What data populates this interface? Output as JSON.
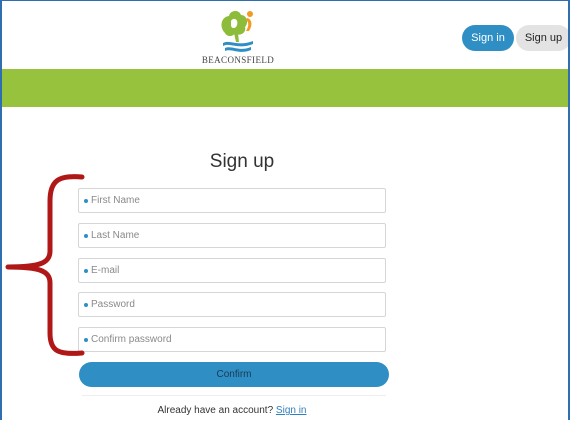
{
  "header": {
    "logo_text": "BEACONSFIELD",
    "signin_label": "Sign in",
    "signup_label": "Sign up"
  },
  "form": {
    "title": "Sign up",
    "fields": [
      {
        "placeholder": "First Name"
      },
      {
        "placeholder": "Last Name"
      },
      {
        "placeholder": "E-mail"
      },
      {
        "placeholder": "Password"
      },
      {
        "placeholder": "Confirm password"
      }
    ],
    "confirm_label": "Confirm",
    "already_text": "Already have an account?",
    "signin_link": "Sign in"
  },
  "colors": {
    "accent_blue": "#2f8fc4",
    "green_band": "#96c23d",
    "annotation_red": "#b01818"
  },
  "icons": [
    "beaconsfield-logo-icon",
    "required-dot-icon",
    "annotation-brace-icon"
  ]
}
